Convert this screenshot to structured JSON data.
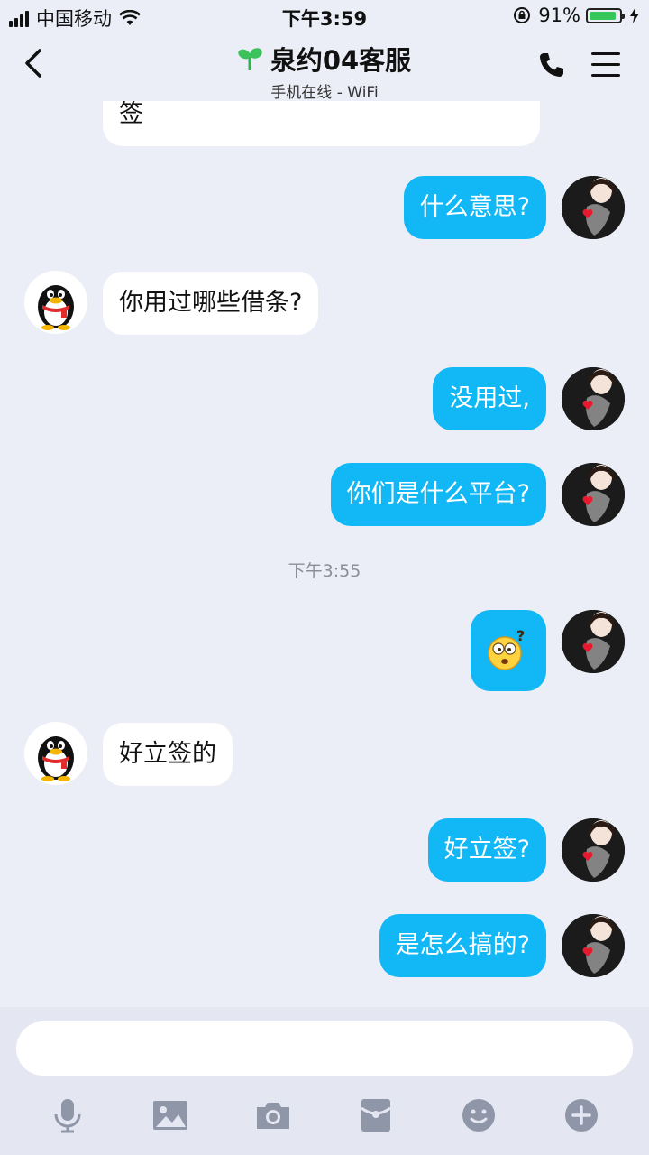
{
  "status_bar": {
    "carrier": "中国移动",
    "time": "下午3:59",
    "battery": "91%",
    "battery_level": 0.91
  },
  "header": {
    "title": "泉约04客服",
    "subtitle": "手机在线 - WiFi"
  },
  "messages": [
    {
      "side": "in",
      "text": "签"
    },
    {
      "side": "out",
      "text": "什么意思?"
    },
    {
      "side": "in",
      "text": "你用过哪些借条?"
    },
    {
      "side": "out",
      "text": "没用过,"
    },
    {
      "side": "out",
      "text": "你们是什么平台?"
    },
    {
      "timestamp": "下午3:55"
    },
    {
      "side": "out",
      "emoji": "confused-face-emoji"
    },
    {
      "side": "in",
      "text": "好立签的"
    },
    {
      "side": "out",
      "text": "好立签?"
    },
    {
      "side": "out",
      "text": "是怎么搞的?"
    }
  ],
  "input": {
    "placeholder": ""
  },
  "toolbar": {
    "icons": [
      "microphone-icon",
      "image-icon",
      "camera-icon",
      "red-packet-icon",
      "emoji-icon",
      "plus-icon"
    ]
  },
  "colors": {
    "out_bubble": "#12b7f5",
    "in_bubble": "#ffffff",
    "background": "#eceef7"
  }
}
